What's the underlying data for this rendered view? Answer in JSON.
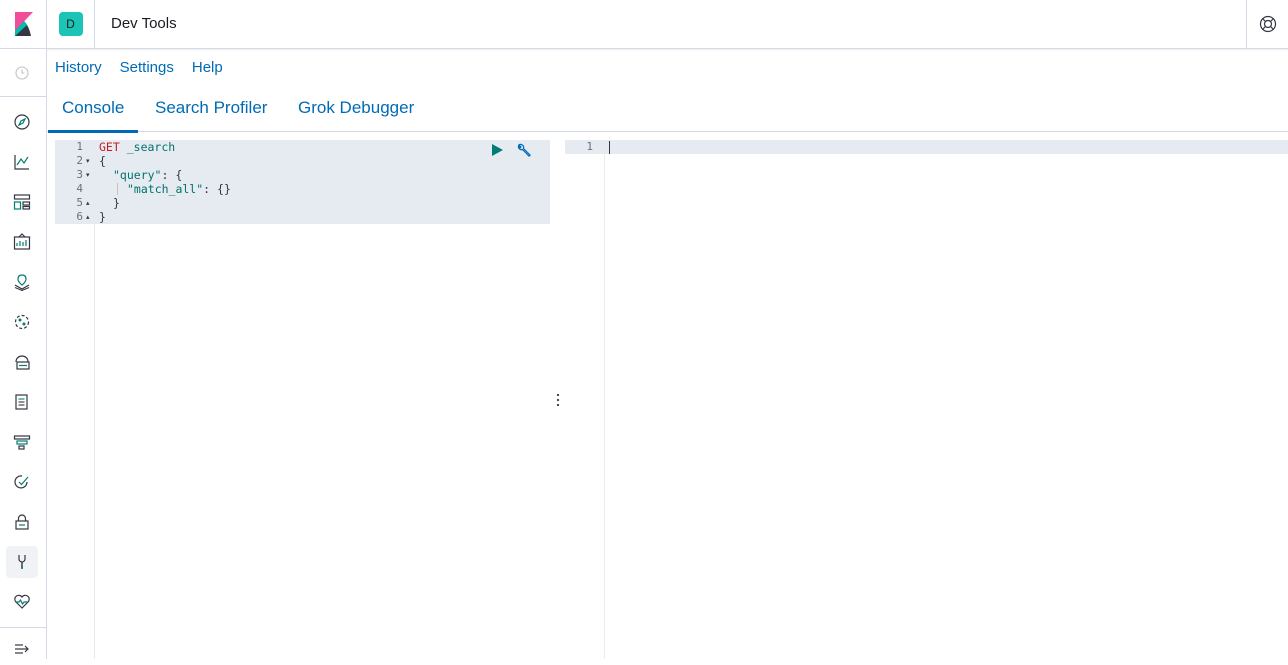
{
  "header": {
    "space_initial": "D",
    "app_title": "Dev Tools"
  },
  "sidenav": {
    "items": [
      {
        "name": "recently-viewed",
        "icon": "clock-icon"
      },
      {
        "name": "discover",
        "icon": "compass-icon"
      },
      {
        "name": "visualize",
        "icon": "chart-icon"
      },
      {
        "name": "dashboard",
        "icon": "dashboard-icon"
      },
      {
        "name": "canvas",
        "icon": "canvas-icon"
      },
      {
        "name": "maps",
        "icon": "map-pin-icon"
      },
      {
        "name": "machine-learning",
        "icon": "ml-icon"
      },
      {
        "name": "infrastructure",
        "icon": "infra-icon"
      },
      {
        "name": "logs",
        "icon": "logs-icon"
      },
      {
        "name": "apm",
        "icon": "apm-icon"
      },
      {
        "name": "uptime",
        "icon": "uptime-icon"
      },
      {
        "name": "siem",
        "icon": "lock-icon"
      },
      {
        "name": "dev-tools",
        "icon": "wrench-icon",
        "active": true
      },
      {
        "name": "monitoring",
        "icon": "heartbeat-icon"
      }
    ],
    "collapse_icon": "collapse-icon"
  },
  "menu": {
    "history": "History",
    "settings": "Settings",
    "help": "Help"
  },
  "tabs": {
    "console": "Console",
    "search_profiler": "Search Profiler",
    "grok_debugger": "Grok Debugger"
  },
  "editor": {
    "lines": [
      {
        "n": "1",
        "fold": ""
      },
      {
        "n": "2",
        "fold": "▾"
      },
      {
        "n": "3",
        "fold": "▾"
      },
      {
        "n": "4",
        "fold": ""
      },
      {
        "n": "5",
        "fold": "▴"
      },
      {
        "n": "6",
        "fold": "▴"
      }
    ],
    "method": "GET",
    "url": "_search",
    "l2": "{",
    "l3_key": "\"query\"",
    "l3_rest": ": {",
    "l4_key": "\"match_all\"",
    "l4_rest": ": {}",
    "l5": "}",
    "l6": "}"
  },
  "output": {
    "line_number": "1"
  },
  "colors": {
    "accent": "#006bb4",
    "play": "#017d73",
    "space_avatar": "#1bc4b4"
  }
}
